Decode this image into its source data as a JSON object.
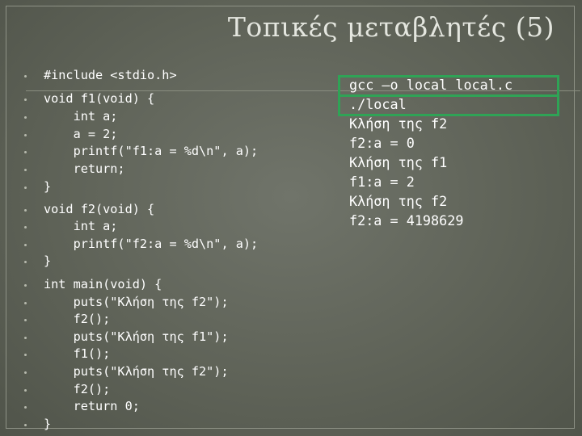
{
  "title": "Τοπικές μεταβλητές (5)",
  "code_lines": [
    "#include <stdio.h>",
    "void f1(void) {",
    "    int a;",
    "    a = 2;",
    "    printf(\"f1:a = %d\\n\", a);",
    "    return;",
    "}",
    "void f2(void) {",
    "    int a;",
    "    printf(\"f2:a = %d\\n\", a);",
    "}",
    "int main(void) {",
    "    puts(\"Κλήση της f2\");",
    "    f2();",
    "    puts(\"Κλήση της f1\");",
    "    f1();",
    "    puts(\"Κλήση της f2\");",
    "    f2();",
    "    return 0;",
    "}"
  ],
  "terminal_lines": [
    "gcc –o local local.c",
    "./local",
    "Κλήση της f2",
    "f2:a = 0",
    "Κλήση της f1",
    "f1:a = 2",
    "Κλήση της f2",
    "f2:a = 4198629"
  ],
  "colors": {
    "background": "#5f6358",
    "text": "#ffffff",
    "highlight_box": "#2fa356"
  }
}
